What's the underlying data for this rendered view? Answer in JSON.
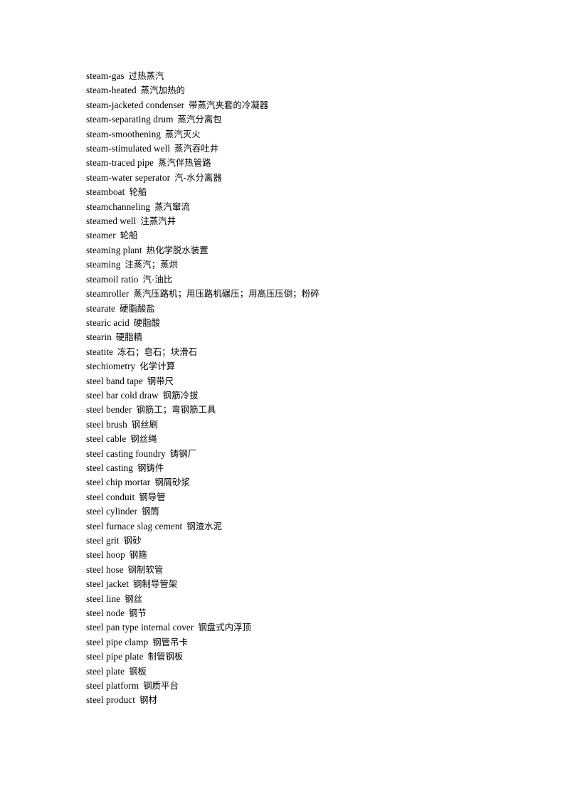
{
  "document": {
    "type": "bilingual-glossary-page",
    "entries": [
      {
        "term": "steam-gas",
        "definition": "过热蒸汽"
      },
      {
        "term": "steam-heated",
        "definition": "蒸汽加热的"
      },
      {
        "term": "steam-jacketed condenser",
        "definition": "带蒸汽夹套的冷凝器"
      },
      {
        "term": "steam-separating drum",
        "definition": "蒸汽分离包"
      },
      {
        "term": "steam-smoothening",
        "definition": "蒸汽灭火"
      },
      {
        "term": "steam-stimulated well",
        "definition": "蒸汽吞吐井"
      },
      {
        "term": "steam-traced pipe",
        "definition": "蒸汽伴热管路"
      },
      {
        "term": "steam-water seperator",
        "definition": "汽-水分离器"
      },
      {
        "term": "steamboat",
        "definition": "轮船"
      },
      {
        "term": "steamchanneling",
        "definition": "蒸汽窜流"
      },
      {
        "term": "steamed well",
        "definition": "注蒸汽井"
      },
      {
        "term": "steamer",
        "definition": "轮船"
      },
      {
        "term": "steaming plant",
        "definition": "热化学脱水装置"
      },
      {
        "term": "steaming",
        "definition": "注蒸汽；蒸烘"
      },
      {
        "term": "steamoil ratio",
        "definition": "汽-油比"
      },
      {
        "term": "steamroller",
        "definition": "蒸汽压路机；用压路机碾压；用高压压倒；粉碎"
      },
      {
        "term": "stearate",
        "definition": "硬脂酸盐"
      },
      {
        "term": "stearic acid",
        "definition": "硬脂酸"
      },
      {
        "term": "stearin",
        "definition": "硬脂精"
      },
      {
        "term": "steatite",
        "definition": "冻石；皂石；块滑石"
      },
      {
        "term": "stechiometry",
        "definition": "化学计算"
      },
      {
        "term": "steel band tape",
        "definition": "钢带尺"
      },
      {
        "term": "steel bar cold draw",
        "definition": "钢筋冷拔"
      },
      {
        "term": "steel bender",
        "definition": "钢筋工；弯钢筋工具"
      },
      {
        "term": "steel brush",
        "definition": "钢丝刷"
      },
      {
        "term": "steel cable",
        "definition": "钢丝绳"
      },
      {
        "term": "steel casting foundry",
        "definition": "铸钢厂"
      },
      {
        "term": "steel casting",
        "definition": "钢铸件"
      },
      {
        "term": "steel chip mortar",
        "definition": "钢屑砂浆"
      },
      {
        "term": "steel conduit",
        "definition": "钢导管"
      },
      {
        "term": "steel cylinder",
        "definition": "钢筒"
      },
      {
        "term": "steel furnace slag cement",
        "definition": "钢渣水泥"
      },
      {
        "term": "steel grit",
        "definition": "钢砂"
      },
      {
        "term": "steel hoop",
        "definition": "钢箍"
      },
      {
        "term": "steel hose",
        "definition": "钢制软管"
      },
      {
        "term": "steel jacket",
        "definition": "钢制导管架"
      },
      {
        "term": "steel line",
        "definition": "钢丝"
      },
      {
        "term": "steel node",
        "definition": "钢节"
      },
      {
        "term": "steel pan type internal cover",
        "definition": "钢盘式内浮顶"
      },
      {
        "term": "steel pipe clamp",
        "definition": "钢管吊卡"
      },
      {
        "term": "steel pipe plate",
        "definition": "制管钢板"
      },
      {
        "term": "steel plate",
        "definition": "钢板"
      },
      {
        "term": "steel platform",
        "definition": "钢质平台"
      },
      {
        "term": "steel product",
        "definition": "钢材"
      }
    ]
  }
}
